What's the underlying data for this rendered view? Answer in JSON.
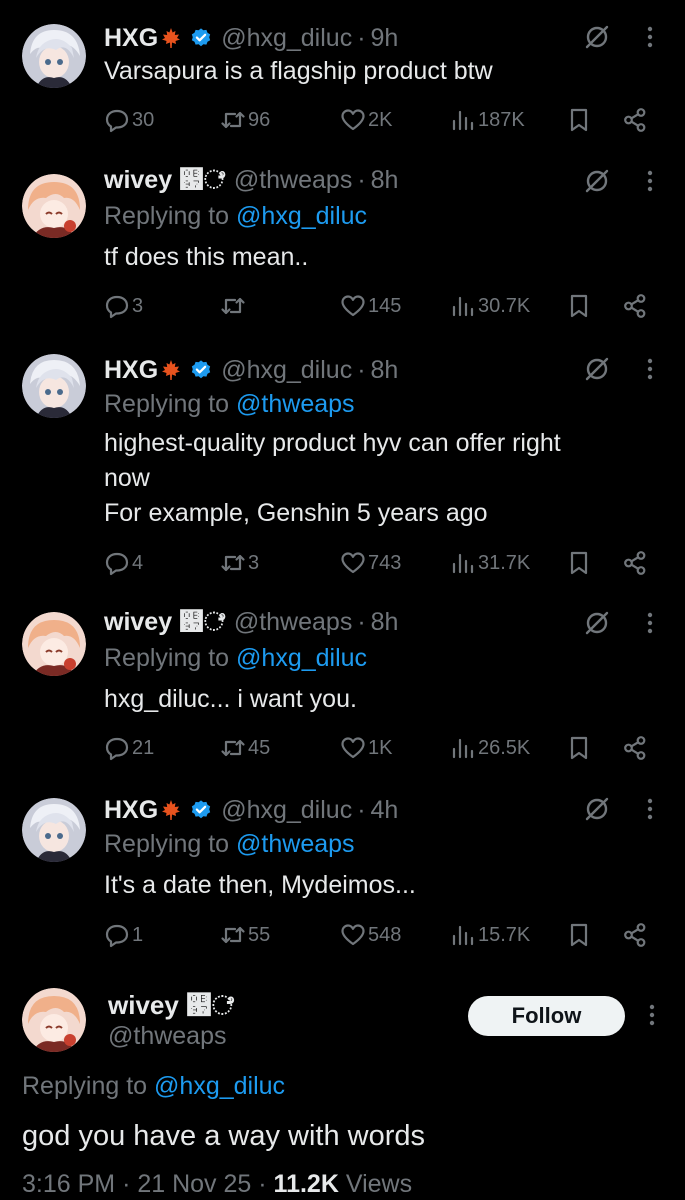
{
  "colors": {
    "background": "#000000",
    "text": "#e7e9ea",
    "muted": "#71767b",
    "link": "#1d9bf0",
    "verified": "#1d9bf0"
  },
  "users": {
    "hxg": {
      "name": "HXG",
      "handle": "@hxg_diluc",
      "emoji": "maple-leaf-icon",
      "verified": true
    },
    "wivey": {
      "name": "wivey ஗ೆ",
      "handle": "@thweaps",
      "verified": false
    }
  },
  "replying_label": "Replying to",
  "tweets": [
    {
      "name": "HXG",
      "handle": "@hxg_diluc",
      "dot": "·",
      "time": "9h",
      "reply_to": "",
      "lines": [
        "Varsapura is a flagship product btw"
      ],
      "replies": "30",
      "reposts": "96",
      "likes": "2K",
      "views": "187K"
    },
    {
      "name": "wivey ஗ೆ",
      "handle": "@thweaps",
      "dot": "·",
      "time": "8h",
      "reply_to": "@hxg_diluc",
      "lines": [
        "tf does this mean.."
      ],
      "replies": "3",
      "reposts": "",
      "likes": "145",
      "views": "30.7K"
    },
    {
      "name": "HXG",
      "handle": "@hxg_diluc",
      "dot": "·",
      "time": "8h",
      "reply_to": "@thweaps",
      "lines": [
        "highest-quality product hyv can offer right",
        "now",
        "For example, Genshin 5 years ago"
      ],
      "replies": "4",
      "reposts": "3",
      "likes": "743",
      "views": "31.7K"
    },
    {
      "name": "wivey ஗ೆ",
      "handle": "@thweaps",
      "dot": "·",
      "time": "8h",
      "reply_to": "@hxg_diluc",
      "lines": [
        "hxg_diluc... i want you."
      ],
      "replies": "21",
      "reposts": "45",
      "likes": "1K",
      "views": "26.5K"
    },
    {
      "name": "HXG",
      "handle": "@hxg_diluc",
      "dot": "·",
      "time": "4h",
      "reply_to": "@thweaps",
      "lines": [
        "It's a date then, Mydeimos..."
      ],
      "replies": "1",
      "reposts": "55",
      "likes": "548",
      "views": "15.7K"
    }
  ],
  "main": {
    "name": "wivey ஗ೆ",
    "handle": "@thweaps",
    "follow_label": "Follow",
    "reply_to": "@hxg_diluc",
    "text": "god you have a way with words",
    "time": "3:16 PM",
    "date": "21 Nov 25",
    "dot": "·",
    "views_count": "11.2K",
    "views_label": "Views"
  }
}
